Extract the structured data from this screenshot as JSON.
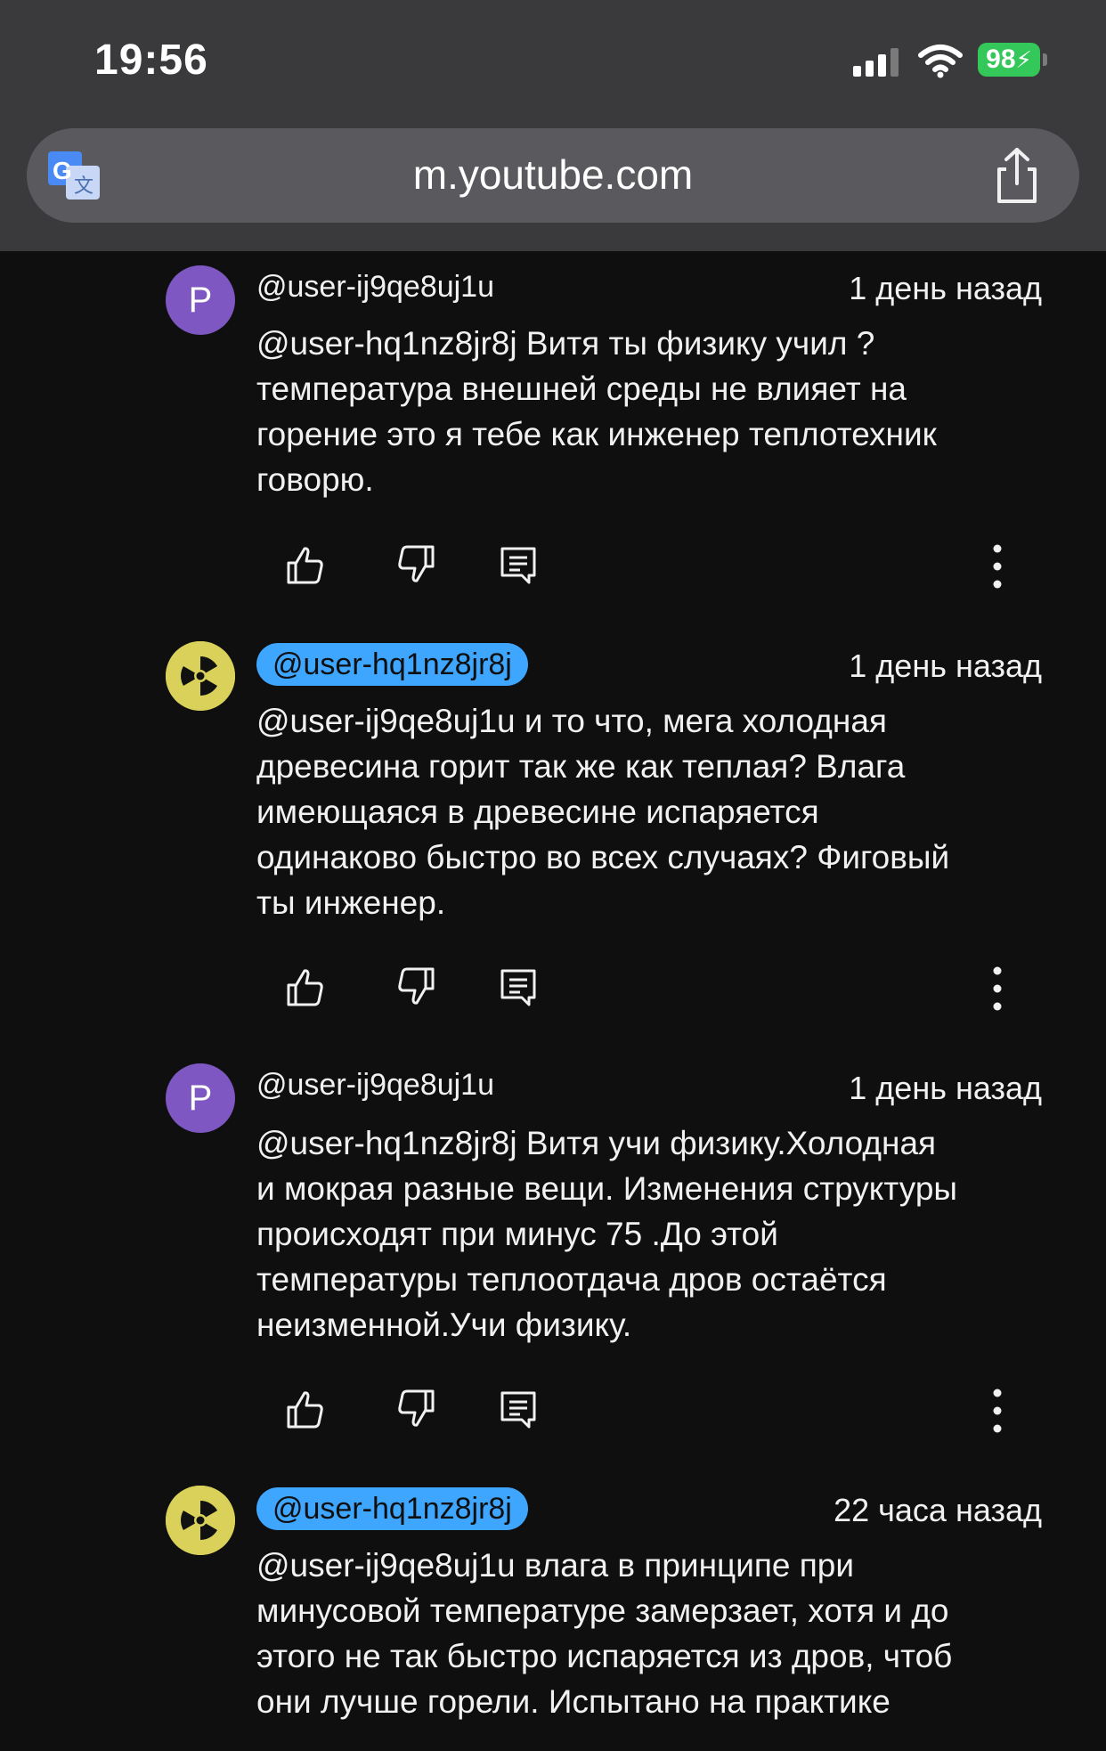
{
  "status": {
    "time": "19:56",
    "battery": "98"
  },
  "browser": {
    "url": "m.youtube.com"
  },
  "comments": [
    {
      "avatar_letter": "P",
      "handle": "@user-ij9qe8uj1u",
      "time": "1 день назад",
      "text": " @user-hq1nz8jr8j  Витя ты физику учил ?\nтемпература внешней среды не влияет на\nгорение это я тебе как инженер теплотехник\nговорю."
    },
    {
      "avatar_letter": "",
      "handle": "@user-hq1nz8jr8j",
      "time": "1 день назад",
      "text": " @user-ij9qe8uj1u  и то что, мега холодная\nдревесина горит так же как теплая? Влага\nимеющаяся в древесине испаряется\nодинаково быстро во всех случаях? Фиговый\nты инженер."
    },
    {
      "avatar_letter": "P",
      "handle": "@user-ij9qe8uj1u",
      "time": "1 день назад",
      "text": " @user-hq1nz8jr8j  Витя учи физику.Холодная\nи мокрая разные вещи. Изменения структуры\nпроисходят при минус 75 .До этой\nтемпературы теплоотдача дров остаётся\nнеизменной.Учи физику."
    },
    {
      "avatar_letter": "",
      "handle": "@user-hq1nz8jr8j",
      "time": "22 часа назад",
      "text": " @user-ij9qe8uj1u  влага в принципе при\nминусовой температуре замерзает, хотя и до\nэтого не так быстро испаряется из дров, чтоб\nони лучше горели. Испытано на практике"
    }
  ],
  "colors": {
    "background": "#0f0f0f",
    "chrome": "#3a3a3c",
    "accent_pill": "#3ea6ff",
    "avatar_purple": "#7e57c2",
    "battery": "#34c759"
  }
}
